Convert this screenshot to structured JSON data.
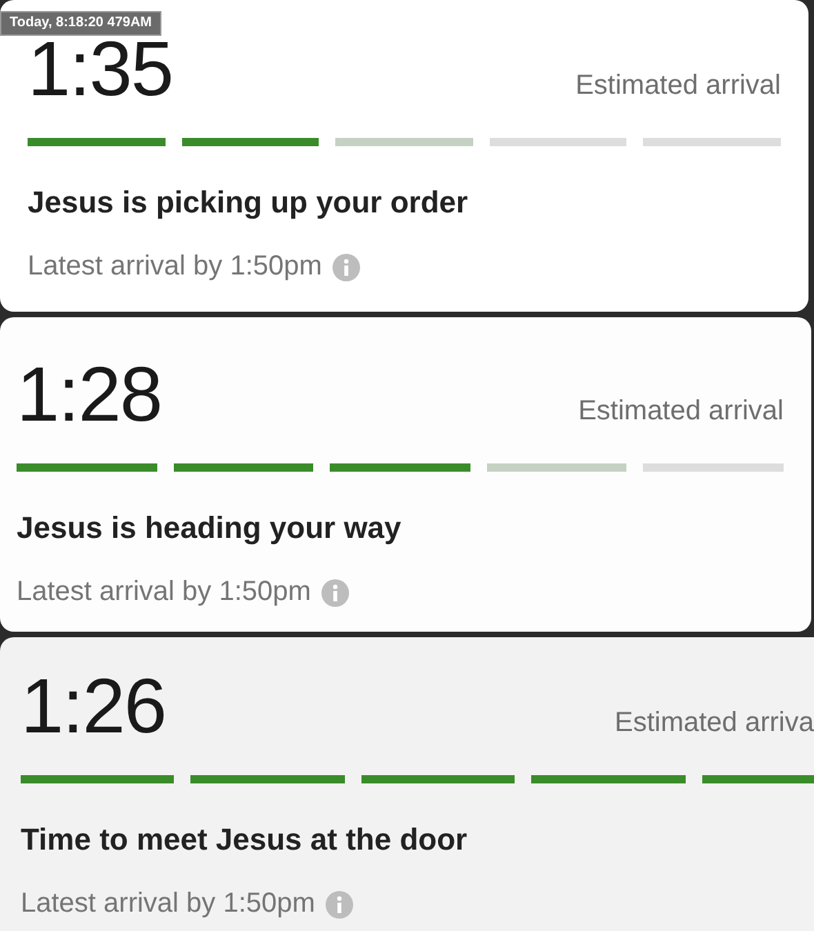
{
  "overlay_label": "Today, 8:18:20 479AM",
  "cards": [
    {
      "time": "1:35",
      "eta_label": "Estimated arrival",
      "status": "Jesus is picking up your order",
      "latest": "Latest arrival by 1:50pm",
      "steps": [
        {
          "done": true,
          "active": false
        },
        {
          "done": true,
          "active": false
        },
        {
          "done": false,
          "active": true
        },
        {
          "done": false,
          "active": false
        },
        {
          "done": false,
          "active": false
        }
      ]
    },
    {
      "time": "1:28",
      "eta_label": "Estimated arrival",
      "status": "Jesus is heading your way",
      "latest": "Latest arrival by 1:50pm",
      "steps": [
        {
          "done": true,
          "active": false
        },
        {
          "done": true,
          "active": false
        },
        {
          "done": true,
          "active": false
        },
        {
          "done": false,
          "active": true
        },
        {
          "done": false,
          "active": false
        }
      ]
    },
    {
      "time": "1:26",
      "eta_label": "Estimated arriva",
      "status": "Time to meet Jesus at the door",
      "latest": "Latest arrival by 1:50pm",
      "steps": [
        {
          "done": true,
          "active": false
        },
        {
          "done": true,
          "active": false
        },
        {
          "done": true,
          "active": false
        },
        {
          "done": true,
          "active": false
        },
        {
          "done": true,
          "active": false
        }
      ]
    }
  ]
}
